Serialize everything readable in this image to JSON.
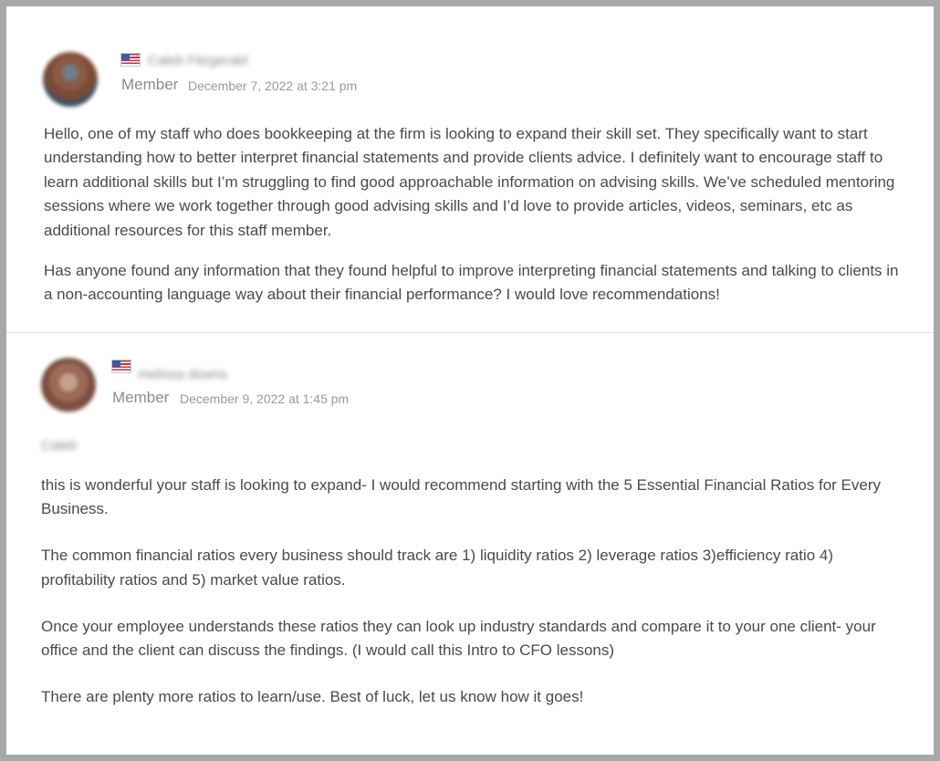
{
  "posts": [
    {
      "author_name": "Caleb Fitzgerald",
      "role": "Member",
      "date": "December 7, 2022 at 3:21 pm",
      "paragraphs": [
        "Hello, one of my staff who does bookkeeping at the firm is looking to expand their skill set. They specifically want to start understanding how to better interpret financial statements and provide clients advice. I definitely want to encourage staff to learn additional skills but I’m struggling to find good approachable information on advising skills. We’ve scheduled mentoring sessions where we work together through good advising skills and I’d love to provide articles, videos, seminars, etc as additional resources for this staff member.",
        "Has anyone found any information that they found helpful to improve interpreting financial statements and talking to clients in a non-accounting language way about their financial performance? I would love recommendations!"
      ]
    },
    {
      "author_name": "melissa downs",
      "role": "Member",
      "date": "December 9, 2022 at 1:45 pm",
      "greeting": "Caleb",
      "paragraphs": [
        "this is wonderful your staff is looking to expand- I would recommend starting with the 5 Essential Financial Ratios for Every Business.",
        "The common financial ratios every business should track are 1) liquidity ratios 2) leverage ratios 3)efficiency ratio 4) profitability ratios and 5) market value ratios.",
        "Once your employee understands these ratios they can look up industry standards and compare it to your one client- your office and the client can discuss the findings. (I would call this Intro to CFO lessons)",
        "There are plenty more ratios to learn/use. Best of luck, let us know how it goes!"
      ]
    }
  ]
}
